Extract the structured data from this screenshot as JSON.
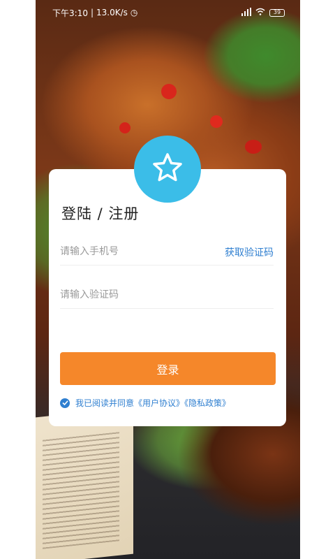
{
  "status_bar": {
    "time": "下午3:10",
    "speed": "13.0K/s",
    "battery": "39"
  },
  "login": {
    "title": "登陆 / 注册",
    "phone_placeholder": "请输入手机号",
    "get_code_label": "获取验证码",
    "code_placeholder": "请输入验证码",
    "submit_label": "登录",
    "agreement_text": "我已阅读并同意《用户协议》《隐私政策》",
    "agreement_checked": true
  },
  "icons": {
    "logo": "star-icon",
    "check": "checkmark-icon"
  },
  "colors": {
    "accent_orange": "#f5872a",
    "link_blue": "#2f7fd0",
    "logo_blue": "#3bbde8"
  }
}
